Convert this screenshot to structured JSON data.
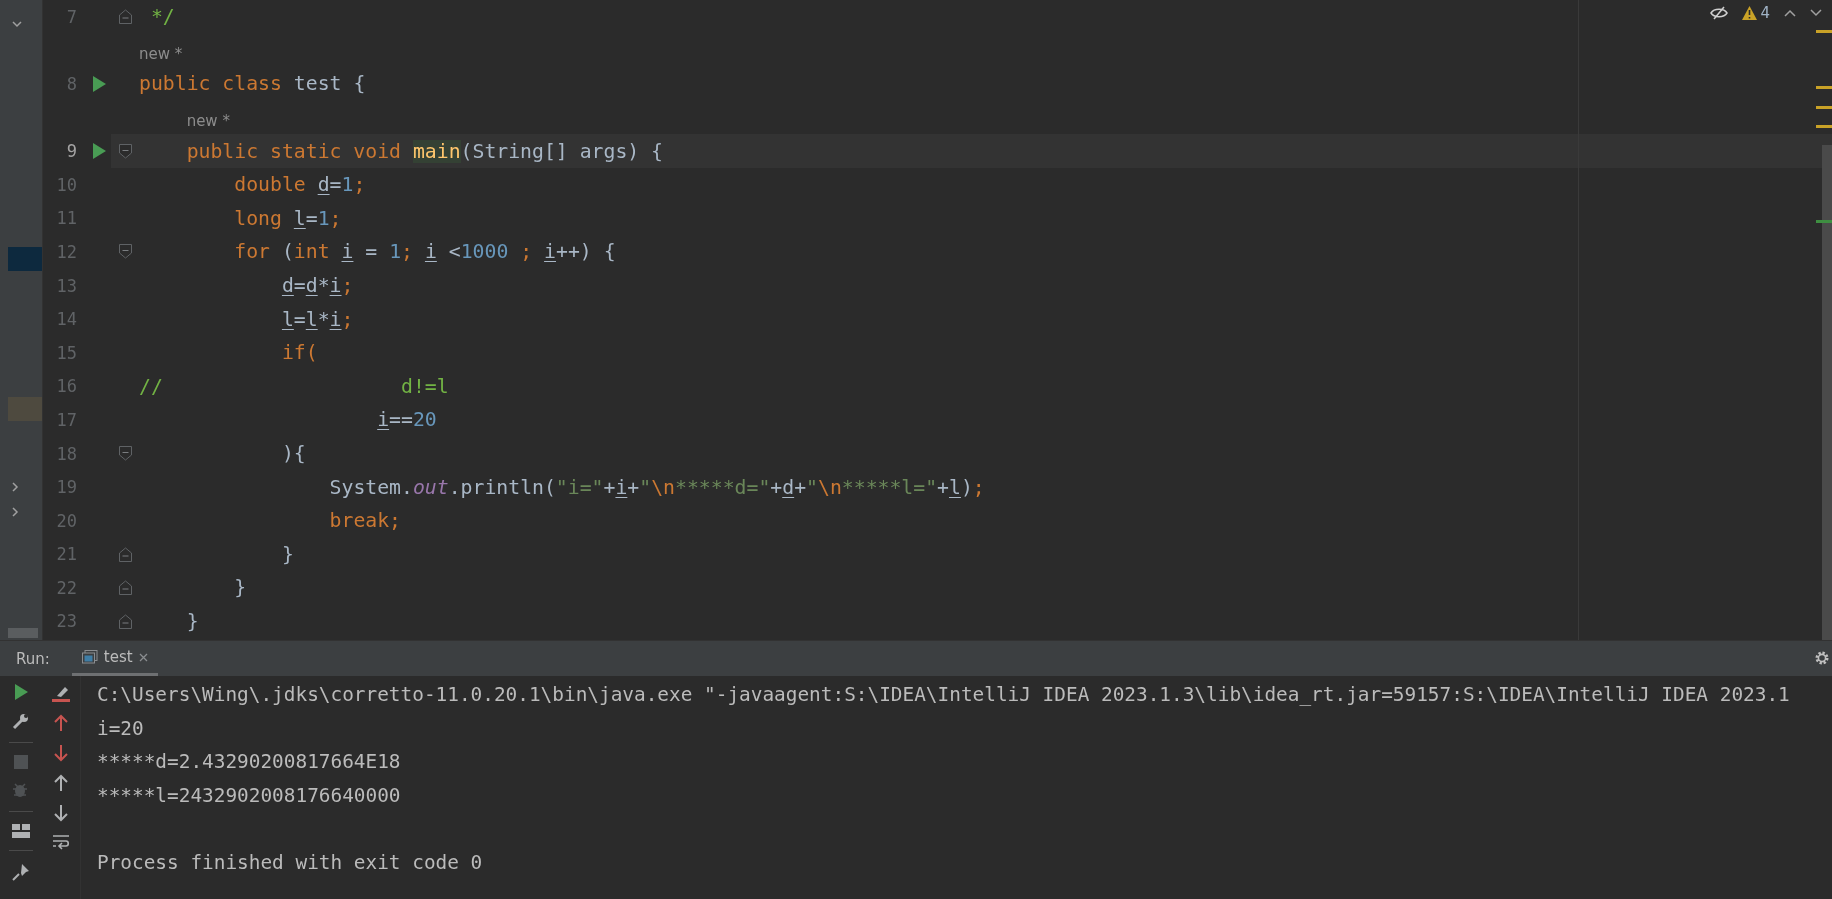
{
  "editor": {
    "lines": [
      {
        "kind": "code",
        "number": "7",
        "run": false,
        "current": false,
        "fold": {
          "kind": "end"
        },
        "tokens": [
          {
            "text": " */",
            "kind": "comment"
          }
        ]
      },
      {
        "kind": "inlay",
        "text": "new *"
      },
      {
        "kind": "code",
        "number": "8",
        "run": true,
        "current": false,
        "tokens": [
          {
            "text": "public class",
            "kind": "keyword"
          },
          {
            "text": " test {",
            "kind": "plain"
          }
        ]
      },
      {
        "kind": "inlay",
        "text": "new *"
      },
      {
        "kind": "code",
        "number": "9",
        "run": true,
        "current": true,
        "fold": {
          "kind": "start"
        },
        "tokens": [
          {
            "text": "    public static void ",
            "kind": "keyword"
          },
          {
            "text": "main",
            "kind": "method"
          },
          {
            "text": "(String[] args) {",
            "kind": "plain"
          }
        ]
      },
      {
        "kind": "code",
        "number": "10",
        "run": false,
        "current": false,
        "tokens": [
          {
            "text": "        double ",
            "kind": "keyword"
          },
          {
            "text": "d",
            "kind": "variable"
          },
          {
            "text": "=",
            "kind": "plain"
          },
          {
            "text": "1",
            "kind": "number"
          },
          {
            "text": ";",
            "kind": "semicolon"
          }
        ]
      },
      {
        "kind": "code",
        "number": "11",
        "run": false,
        "current": false,
        "tokens": [
          {
            "text": "        long ",
            "kind": "keyword"
          },
          {
            "text": "l",
            "kind": "variable"
          },
          {
            "text": "=",
            "kind": "plain"
          },
          {
            "text": "1",
            "kind": "number"
          },
          {
            "text": ";",
            "kind": "semicolon"
          }
        ]
      },
      {
        "kind": "code",
        "number": "12",
        "run": false,
        "current": false,
        "fold": {
          "kind": "start"
        },
        "tokens": [
          {
            "text": "        for",
            "kind": "keyword"
          },
          {
            "text": " (",
            "kind": "plain"
          },
          {
            "text": "int ",
            "kind": "keyword"
          },
          {
            "text": "i",
            "kind": "variable"
          },
          {
            "text": " = ",
            "kind": "plain"
          },
          {
            "text": "1",
            "kind": "number"
          },
          {
            "text": "; ",
            "kind": "semicolon"
          },
          {
            "text": "i",
            "kind": "variable"
          },
          {
            "text": " <",
            "kind": "plain"
          },
          {
            "text": "1000",
            "kind": "number"
          },
          {
            "text": " ; ",
            "kind": "semicolon"
          },
          {
            "text": "i",
            "kind": "variable"
          },
          {
            "text": "++) {",
            "kind": "plain"
          }
        ]
      },
      {
        "kind": "code",
        "number": "13",
        "run": false,
        "current": false,
        "tokens": [
          {
            "text": "            d",
            "kind": "variable"
          },
          {
            "text": "=",
            "kind": "plain"
          },
          {
            "text": "d",
            "kind": "variable"
          },
          {
            "text": "*",
            "kind": "plain"
          },
          {
            "text": "i",
            "kind": "variable"
          },
          {
            "text": ";",
            "kind": "semicolon"
          }
        ]
      },
      {
        "kind": "code",
        "number": "14",
        "run": false,
        "current": false,
        "tokens": [
          {
            "text": "            l",
            "kind": "variable"
          },
          {
            "text": "=",
            "kind": "plain"
          },
          {
            "text": "l",
            "kind": "variable"
          },
          {
            "text": "*",
            "kind": "plain"
          },
          {
            "text": "i",
            "kind": "variable"
          },
          {
            "text": ";",
            "kind": "semicolon"
          }
        ]
      },
      {
        "kind": "code",
        "number": "15",
        "run": false,
        "current": false,
        "tokens": [
          {
            "text": "            if(",
            "kind": "keyword"
          }
        ]
      },
      {
        "kind": "code",
        "number": "16",
        "run": false,
        "current": false,
        "tokens": [
          {
            "text": "//                    d!=l",
            "kind": "comment"
          }
        ]
      },
      {
        "kind": "code",
        "number": "17",
        "run": false,
        "current": false,
        "tokens": [
          {
            "text": "                    i",
            "kind": "variable"
          },
          {
            "text": "==",
            "kind": "plain"
          },
          {
            "text": "20",
            "kind": "number"
          }
        ]
      },
      {
        "kind": "code",
        "number": "18",
        "run": false,
        "current": false,
        "fold": {
          "kind": "start"
        },
        "tokens": [
          {
            "text": "            ){",
            "kind": "plain"
          }
        ]
      },
      {
        "kind": "code",
        "number": "19",
        "run": false,
        "current": false,
        "tokens": [
          {
            "text": "                System.",
            "kind": "plain"
          },
          {
            "text": "out",
            "kind": "field"
          },
          {
            "text": ".println(",
            "kind": "plain"
          },
          {
            "text": "\"i=\"",
            "kind": "string"
          },
          {
            "text": "+",
            "kind": "plain"
          },
          {
            "text": "i",
            "kind": "variable"
          },
          {
            "text": "+",
            "kind": "plain"
          },
          {
            "text": "\"",
            "kind": "string"
          },
          {
            "text": "\\n",
            "kind": "escape"
          },
          {
            "text": "*****d=\"",
            "kind": "string"
          },
          {
            "text": "+",
            "kind": "plain"
          },
          {
            "text": "d",
            "kind": "variable"
          },
          {
            "text": "+",
            "kind": "plain"
          },
          {
            "text": "\"",
            "kind": "string"
          },
          {
            "text": "\\n",
            "kind": "escape"
          },
          {
            "text": "*****l=\"",
            "kind": "string"
          },
          {
            "text": "+",
            "kind": "plain"
          },
          {
            "text": "l",
            "kind": "variable"
          },
          {
            "text": ")",
            "kind": "plain"
          },
          {
            "text": ";",
            "kind": "semicolon"
          }
        ]
      },
      {
        "kind": "code",
        "number": "20",
        "run": false,
        "current": false,
        "tokens": [
          {
            "text": "                break;",
            "kind": "keyword"
          }
        ]
      },
      {
        "kind": "code",
        "number": "21",
        "run": false,
        "current": false,
        "fold": {
          "kind": "end"
        },
        "tokens": [
          {
            "text": "            }",
            "kind": "plain"
          }
        ]
      },
      {
        "kind": "code",
        "number": "22",
        "run": false,
        "current": false,
        "fold": {
          "kind": "end"
        },
        "tokens": [
          {
            "text": "        }",
            "kind": "plain"
          }
        ]
      },
      {
        "kind": "code",
        "number": "23",
        "run": false,
        "current": false,
        "fold": {
          "kind": "end"
        },
        "tokens": [
          {
            "text": "    }",
            "kind": "plain"
          }
        ]
      }
    ],
    "inspections": {
      "warnings": "4"
    }
  },
  "run_panel": {
    "label": "Run:",
    "tabs": [
      {
        "label": "test",
        "selected": true
      }
    ],
    "console": {
      "lines": [
        "C:\\Users\\Wing\\.jdks\\corretto-11.0.20.1\\bin\\java.exe \"-javaagent:S:\\IDEA\\IntelliJ IDEA 2023.1.3\\lib\\idea_rt.jar=59157:S:\\IDEA\\IntelliJ IDEA 2023.1",
        "i=20",
        "*****d=2.43290200817664E18",
        "*****l=2432902008176640000"
      ],
      "exit_message": "Process finished with exit code 0"
    }
  }
}
